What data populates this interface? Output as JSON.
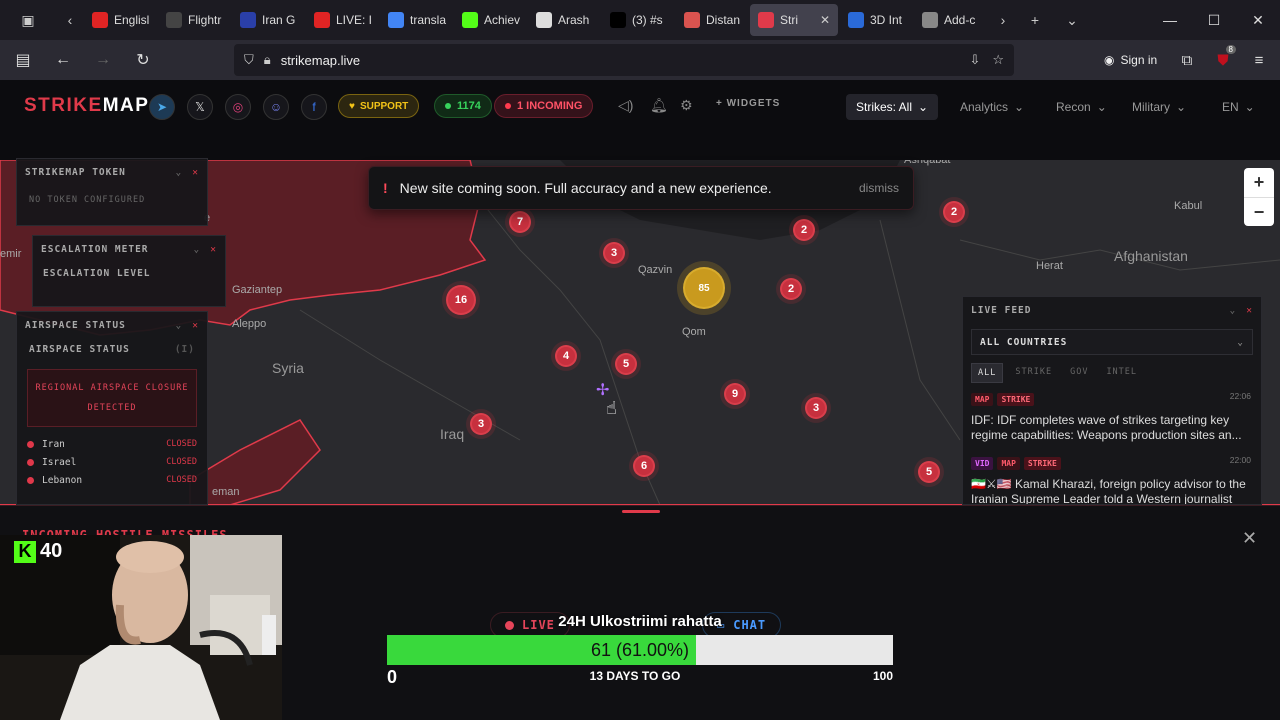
{
  "browser": {
    "tabs": [
      {
        "label": "Englisl",
        "icon": "youtube-icon",
        "color": "#e02424"
      },
      {
        "label": "Flightr",
        "icon": "flightradar-icon",
        "color": "#444"
      },
      {
        "label": "Iran G",
        "icon": "xi-icon",
        "color": "#2a3fa8"
      },
      {
        "label": "LIVE: I",
        "icon": "youtube-icon",
        "color": "#e02424"
      },
      {
        "label": "transla",
        "icon": "google-icon",
        "color": "#4285f4"
      },
      {
        "label": "Achiev",
        "icon": "kick-icon",
        "color": "#53fc18"
      },
      {
        "label": "Arash",
        "icon": "wikipedia-icon",
        "color": "#ddd"
      },
      {
        "label": "(3) #s",
        "icon": "x-icon",
        "color": "#000"
      },
      {
        "label": "Distan",
        "icon": "map-icon",
        "color": "#d9534f"
      },
      {
        "label": "Stri",
        "icon": "strikemap-icon",
        "color": "#e03a4a",
        "active": true
      },
      {
        "label": "3D Int",
        "icon": "globe-icon",
        "color": "#2a6ad8"
      },
      {
        "label": "Add-c",
        "icon": "puzzle-icon",
        "color": "#888"
      }
    ],
    "url": "strikemap.live",
    "signin_label": "Sign in",
    "ext_badge": "8"
  },
  "site": {
    "logo_a": "STRIKE",
    "logo_b": "MAP",
    "support_label": "SUPPORT",
    "online_count": "1174",
    "incoming_label": "1 INCOMING",
    "widgets_label": "+ WIDGETS",
    "menus": [
      {
        "label": "Strikes: All",
        "active": true
      },
      {
        "label": "Analytics"
      },
      {
        "label": "Recon"
      },
      {
        "label": "Military"
      },
      {
        "label": "EN"
      }
    ]
  },
  "banner": {
    "text": "New site coming soon. Full accuracy and a new experience.",
    "dismiss": "dismiss"
  },
  "map": {
    "places": [
      {
        "name": "Gaziantep"
      },
      {
        "name": "Aleppo"
      },
      {
        "name": "Syria"
      },
      {
        "name": "Iraq"
      },
      {
        "name": "Qazvin"
      },
      {
        "name": "Qom"
      },
      {
        "name": "Herat"
      },
      {
        "name": "Afghanistan"
      },
      {
        "name": "Kabul"
      },
      {
        "name": "eman"
      },
      {
        "name": "emir"
      },
      {
        "name": "e"
      },
      {
        "name": "Ashqabat"
      }
    ],
    "clusters": [
      {
        "label": "7"
      },
      {
        "label": "3"
      },
      {
        "label": "2"
      },
      {
        "label": "2"
      },
      {
        "label": "2"
      },
      {
        "label": "85",
        "big": true
      },
      {
        "label": "16"
      },
      {
        "label": "4"
      },
      {
        "label": "5"
      },
      {
        "label": "9"
      },
      {
        "label": "3"
      },
      {
        "label": "3"
      },
      {
        "label": "6"
      },
      {
        "label": "5"
      }
    ]
  },
  "panels": {
    "token": {
      "title": "STRIKEMAP TOKEN",
      "body": "NO TOKEN CONFIGURED"
    },
    "escalation": {
      "title": "ESCALATION METER",
      "body": "ESCALATION LEVEL"
    },
    "airspace": {
      "title": "AIRSPACE STATUS",
      "subtitle": "AIRSPACE STATUS",
      "count": "(I)",
      "alert_line1": "REGIONAL AIRSPACE CLOSURE",
      "alert_line2": "DETECTED",
      "rows": [
        {
          "country": "Iran",
          "status": "CLOSED"
        },
        {
          "country": "Israel",
          "status": "CLOSED"
        },
        {
          "country": "Lebanon",
          "status": "CLOSED"
        }
      ]
    },
    "livefeed": {
      "title": "LIVE FEED",
      "select": "ALL COUNTRIES",
      "filters": [
        "ALL",
        "STRIKE",
        "GOV",
        "INTEL"
      ],
      "items": [
        {
          "tags": [
            "MAP",
            "STRIKE"
          ],
          "time": "22:06",
          "text": "IDF: IDF completes wave of strikes targeting key regime capabilities: Weapons production sites an..."
        },
        {
          "tags": [
            "VID",
            "MAP",
            "STRIKE"
          ],
          "time": "22:00",
          "text": "🇮🇷⚔🇺🇸 Kamal Kharazi, foreign policy advisor to the Iranian Supreme Leader told a Western journalist"
        }
      ]
    }
  },
  "dock": {
    "title": "INCOMING HOSTILE MISSILES",
    "live_label": "LIVE",
    "chat_label": "CHAT"
  },
  "stream": {
    "kick_count": "40",
    "goal_title": "24H Ulkostriimi rahatta",
    "goal_progress_label": "61 (61.00%)",
    "goal_progress_fraction": 0.61,
    "goal_min": "0",
    "goal_max": "100",
    "goal_days": "13 DAYS TO GO"
  },
  "colors": {
    "accent": "#e03a4a",
    "green": "#39d93c",
    "gold": "#c99a1e"
  }
}
